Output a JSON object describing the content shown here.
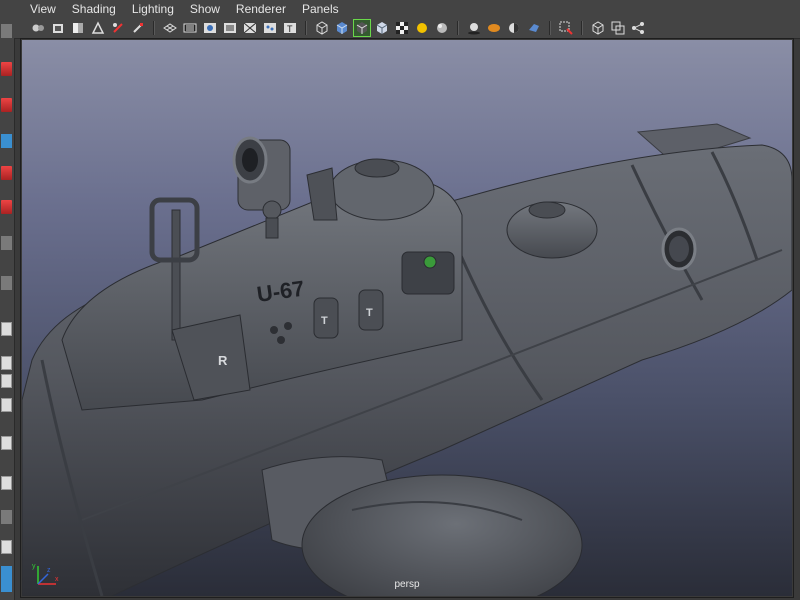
{
  "menu": {
    "items": [
      "View",
      "Shading",
      "Lighting",
      "Show",
      "Renderer",
      "Panels"
    ]
  },
  "toolbar": {
    "icons": [
      "camera-select-icon",
      "camera-attributes-icon",
      "bookmark-icon",
      "image-plane-icon",
      "grease-pencil-icon",
      "wireframe-on-shaded-icon",
      "grid-icon",
      "film-gate-icon",
      "resolution-gate-icon",
      "gate-mask-icon",
      "field-chart-icon",
      "safe-title-icon",
      "wireframe-icon",
      "smooth-shade-icon",
      "isolate-select-icon",
      "xray-icon",
      "default-lighting-icon",
      "shadows-icon",
      "ambient-occlusion-icon",
      "motion-blur-icon",
      "antialias-icon",
      "depth-of-field-icon",
      "select-camera-icon",
      "isolate-icon",
      "single-view-icon",
      "node-editor-icon"
    ]
  },
  "viewport": {
    "camera_label": "persp",
    "hull_marking": "U-67",
    "hatch_letter_left": "R",
    "hatch_letter_t1": "T",
    "hatch_letter_t2": "T",
    "axis_labels": {
      "x": "x",
      "y": "y",
      "z": "z"
    }
  },
  "colors": {
    "ui_bg": "#444444",
    "viewport_top": "#8a8ea6",
    "viewport_bottom": "#2a2d38",
    "hull": "#5a5d64",
    "active_green": "#6ad84a"
  }
}
